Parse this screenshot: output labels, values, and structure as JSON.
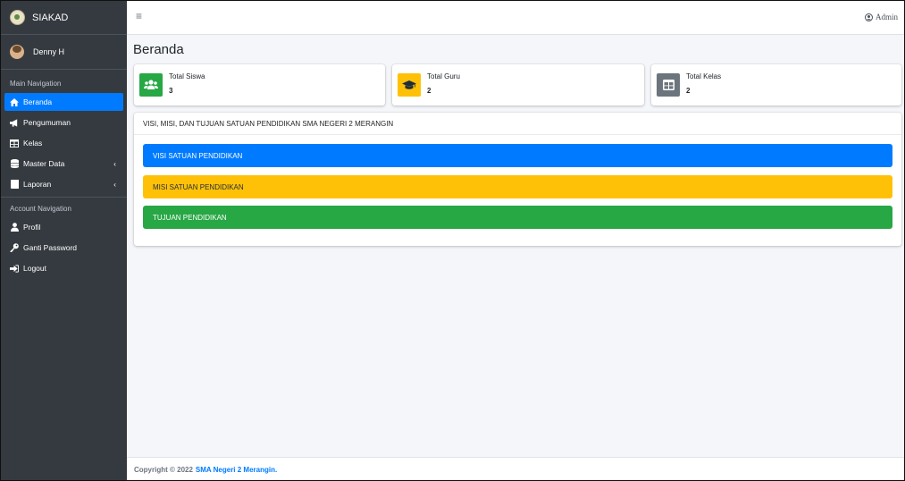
{
  "brand": {
    "title": "SIAKAD"
  },
  "user": {
    "name": "Denny H"
  },
  "sidebar": {
    "main_header": "Main Navigation",
    "main_items": [
      {
        "label": "Beranda",
        "icon": "home-icon",
        "active": true
      },
      {
        "label": "Pengumuman",
        "icon": "bullhorn-icon"
      },
      {
        "label": "Kelas",
        "icon": "table-icon"
      },
      {
        "label": "Master Data",
        "icon": "database-icon",
        "caret": "‹"
      },
      {
        "label": "Laporan",
        "icon": "book-icon",
        "caret": "‹"
      }
    ],
    "account_header": "Account Navigation",
    "account_items": [
      {
        "label": "Profil",
        "icon": "user-icon"
      },
      {
        "label": "Ganti Password",
        "icon": "key-icon"
      },
      {
        "label": "Logout",
        "icon": "sign-out-icon"
      }
    ]
  },
  "navbar": {
    "menu_glyph": "≡",
    "user_label": "Admin"
  },
  "page": {
    "title": "Beranda"
  },
  "info_boxes": [
    {
      "label": "Total Siswa",
      "value": "3",
      "color": "#28a745",
      "icon": "users-icon"
    },
    {
      "label": "Total Guru",
      "value": "2",
      "color": "#ffc107",
      "icon": "graduation-cap-icon"
    },
    {
      "label": "Total Kelas",
      "value": "2",
      "color": "#6c757d",
      "icon": "table-icon"
    }
  ],
  "card": {
    "title": "VISI, MISI, DAN TUJUAN SATUAN PENDIDIKAN SMA NEGERI 2 MERANGIN",
    "sections": [
      {
        "label": "VISI SATUAN PENDIDIKAN",
        "color": "#007bff"
      },
      {
        "label": "MISI SATUAN PENDIDIKAN",
        "color": "#ffc107"
      },
      {
        "label": "TUJUAN PENDIDIKAN",
        "color": "#28a745"
      }
    ]
  },
  "footer": {
    "prefix": "Copyright © 2022",
    "link": "SMA Negeri 2 Merangin."
  }
}
